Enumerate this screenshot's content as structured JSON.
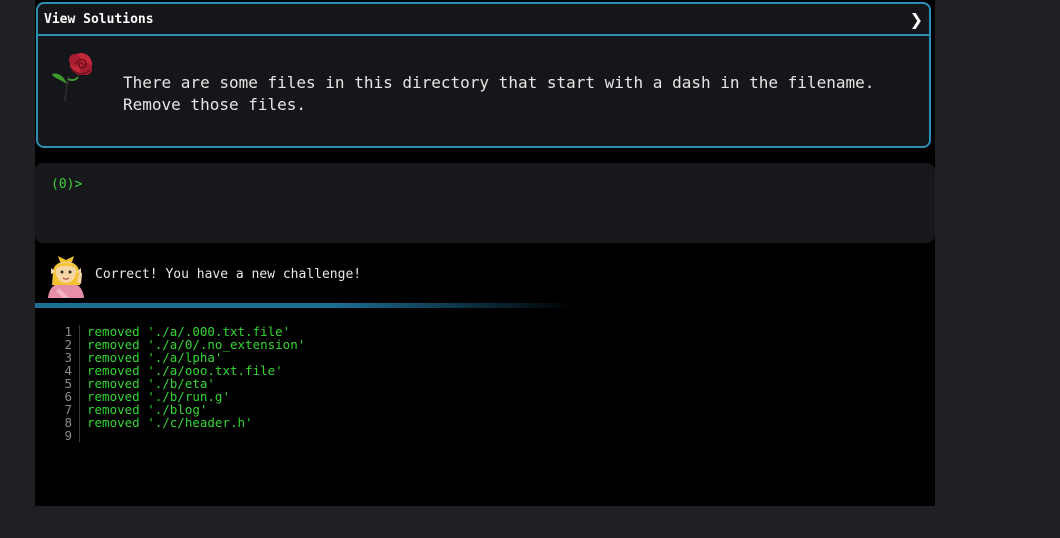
{
  "solutions": {
    "title": "View Solutions",
    "toggle_glyph": "❯"
  },
  "challenge": {
    "icon": "rose-icon",
    "text": "There are some files in this directory that start with a dash in the filename.\nRemove those files."
  },
  "terminal": {
    "prompt": "(0)>"
  },
  "feedback": {
    "icon": "elf-icon",
    "message": "Correct! You have a new challenge!"
  },
  "output": {
    "lines": [
      {
        "no": "1",
        "text": "removed './a/.000.txt.file'"
      },
      {
        "no": "2",
        "text": "removed './a/0/.no_extension'"
      },
      {
        "no": "3",
        "text": "removed './a/lpha'"
      },
      {
        "no": "4",
        "text": "removed './a/ooo.txt.file'"
      },
      {
        "no": "5",
        "text": "removed './b/eta'"
      },
      {
        "no": "6",
        "text": "removed './b/run.g'"
      },
      {
        "no": "7",
        "text": "removed './blog'"
      },
      {
        "no": "8",
        "text": "removed './c/header.h'"
      },
      {
        "no": "9",
        "text": ""
      }
    ]
  },
  "colors": {
    "accent": "#2b8fb3",
    "terminal_green": "#33d633",
    "background": "#000000"
  }
}
